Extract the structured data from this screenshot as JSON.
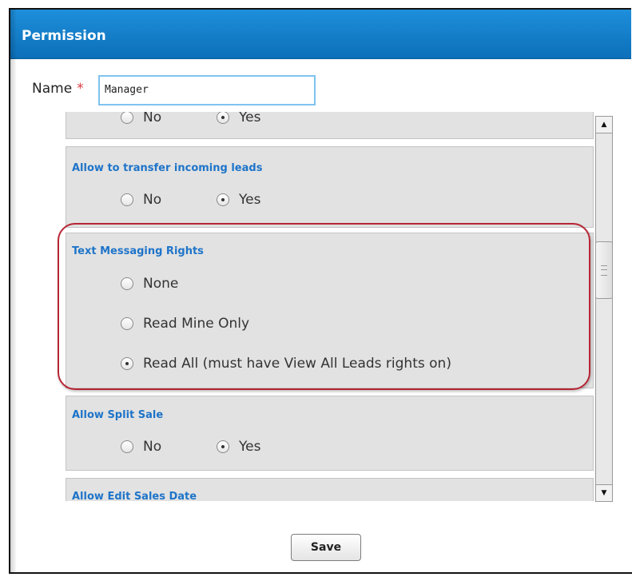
{
  "dialog": {
    "title": "Permission",
    "accent_color": "#1a82d0"
  },
  "name_field": {
    "label": "Name",
    "required_marker": "*",
    "value": "Manager"
  },
  "sections": {
    "partial_top": {
      "options": [
        {
          "label": "No",
          "selected": false
        },
        {
          "label": "Yes",
          "selected": true
        }
      ]
    },
    "transfer_leads": {
      "title": "Allow to transfer incoming leads",
      "options": [
        {
          "label": "No",
          "selected": false
        },
        {
          "label": "Yes",
          "selected": true
        }
      ]
    },
    "text_messaging": {
      "title": "Text Messaging Rights",
      "options": [
        {
          "label": "None",
          "selected": false
        },
        {
          "label": "Read Mine Only",
          "selected": false
        },
        {
          "label": "Read All (must have View All Leads rights on)",
          "selected": true
        }
      ]
    },
    "split_sale": {
      "title": "Allow Split Sale",
      "options": [
        {
          "label": "No",
          "selected": false
        },
        {
          "label": "Yes",
          "selected": true
        }
      ]
    },
    "edit_sales_date": {
      "title": "Allow Edit Sales Date"
    }
  },
  "scrollbar": {
    "up_icon": "▲",
    "down_icon": "▼"
  },
  "footer": {
    "save_label": "Save"
  }
}
